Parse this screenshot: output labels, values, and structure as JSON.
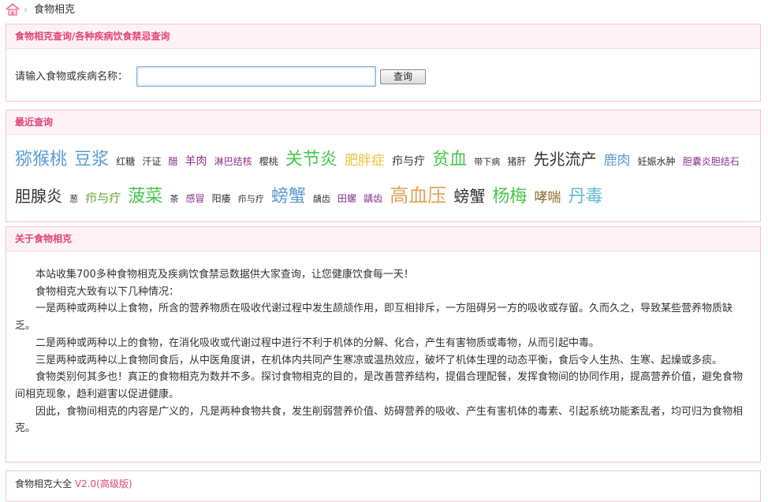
{
  "breadcrumb": {
    "home_icon": "home-icon",
    "separator": "›",
    "current": "食物相克"
  },
  "search_box": {
    "title": "食物相克查询/各种疾病饮食禁忌查询",
    "label": "请输入食物或疾病名称：",
    "input_value": "",
    "button_label": "查询"
  },
  "recent": {
    "title": "最近查询",
    "tags": [
      {
        "text": "猕猴桃",
        "size": 22,
        "color": "#5b9bd1"
      },
      {
        "text": "豆浆",
        "size": 22,
        "color": "#5b9bd1"
      },
      {
        "text": "红糖",
        "size": 12,
        "color": "#333333"
      },
      {
        "text": "汗证",
        "size": 12,
        "color": "#333333"
      },
      {
        "text": "醋",
        "size": 12,
        "color": "#8c2f8c"
      },
      {
        "text": "羊肉",
        "size": 14,
        "color": "#8c2f8c"
      },
      {
        "text": "淋巴结核",
        "size": 12,
        "color": "#8c2f8c"
      },
      {
        "text": "樱桃",
        "size": 12,
        "color": "#333333"
      },
      {
        "text": "关节炎",
        "size": 22,
        "color": "#46c84a"
      },
      {
        "text": "肥胖症",
        "size": 17,
        "color": "#e8c53c"
      },
      {
        "text": "疖与疔",
        "size": 14,
        "color": "#333333"
      },
      {
        "text": "贫血",
        "size": 22,
        "color": "#46c84a"
      },
      {
        "text": "带下病",
        "size": 11,
        "color": "#333333"
      },
      {
        "text": "猪肝",
        "size": 12,
        "color": "#333333"
      },
      {
        "text": "先兆流产",
        "size": 20,
        "color": "#333333"
      },
      {
        "text": "鹿肉",
        "size": 17,
        "color": "#5b9bd1"
      },
      {
        "text": "妊娠水肿",
        "size": 12,
        "color": "#333333"
      },
      {
        "text": "胆囊炎胆结石",
        "size": 12,
        "color": "#8c2f8c"
      },
      {
        "text": "胆腺炎",
        "size": 20,
        "color": "#333333"
      },
      {
        "text": "葱",
        "size": 11,
        "color": "#333333"
      },
      {
        "text": "疖与疔",
        "size": 15,
        "color": "#6aa23a"
      },
      {
        "text": "菠菜",
        "size": 22,
        "color": "#46c84a"
      },
      {
        "text": "茶",
        "size": 11,
        "color": "#333333"
      },
      {
        "text": "感冒",
        "size": 12,
        "color": "#8c2f8c"
      },
      {
        "text": "阳痿",
        "size": 12,
        "color": "#333333"
      },
      {
        "text": "疖与疔",
        "size": 11,
        "color": "#333333"
      },
      {
        "text": "螃蟹",
        "size": 22,
        "color": "#5b9bd1"
      },
      {
        "text": "龋齿",
        "size": 11,
        "color": "#333333"
      },
      {
        "text": "田螺",
        "size": 12,
        "color": "#8c2f8c"
      },
      {
        "text": "龋齿",
        "size": 12,
        "color": "#8c2f8c"
      },
      {
        "text": "高血压",
        "size": 24,
        "color": "#e2a25c"
      },
      {
        "text": "螃蟹",
        "size": 20,
        "color": "#333333"
      },
      {
        "text": "杨梅",
        "size": 22,
        "color": "#46c84a"
      },
      {
        "text": "哮喘",
        "size": 17,
        "color": "#8c6b2f"
      },
      {
        "text": "丹毒",
        "size": 22,
        "color": "#5bbcd1"
      }
    ]
  },
  "about": {
    "title": "关于食物相克",
    "paragraphs": [
      "本站收集700多种食物相克及疾病饮食禁忌数据供大家查询，让您健康饮食每一天！",
      "食物相克大致有以下几种情况：",
      "一是两种或两种以上食物，所含的营养物质在吸收代谢过程中发生颉颃作用，即互相排斥，一方阻碍另一方的吸收或存留。久而久之，导致某些营养物质缺乏。",
      "二是两种或两种以上的食物，在消化吸收或代谢过程中进行不利于机体的分解、化合，产生有害物质或毒物，从而引起中毒。",
      "三是两种或两种以上食物同食后，从中医角度讲，在机体内共同产生寒凉或温热效应，破坏了机体生理的动态平衡，食后令人生热、生寒、起燥或多痰。",
      "食物类别何其多也！真正的食物相克为数并不多。探讨食物相克的目的，是改善营养结构，提倡合理配餐，发挥食物间的协同作用，提高营养价值，避免食物间相克现象，趋利避害以促进健康。",
      "因此，食物间相克的内容是广义的，凡是两种食物共食，发生削弱营养价值、妨碍营养的吸收、产生有害机体的毒素、引起系统功能紊乱者，均可归为食物相克。"
    ]
  },
  "version_box": {
    "title": "食物相克大全",
    "version": "V2.0(高级版)"
  },
  "colors": {
    "accent": "#e0447b",
    "border": "#f2c6d4",
    "header_bg": "#fff2f6"
  }
}
